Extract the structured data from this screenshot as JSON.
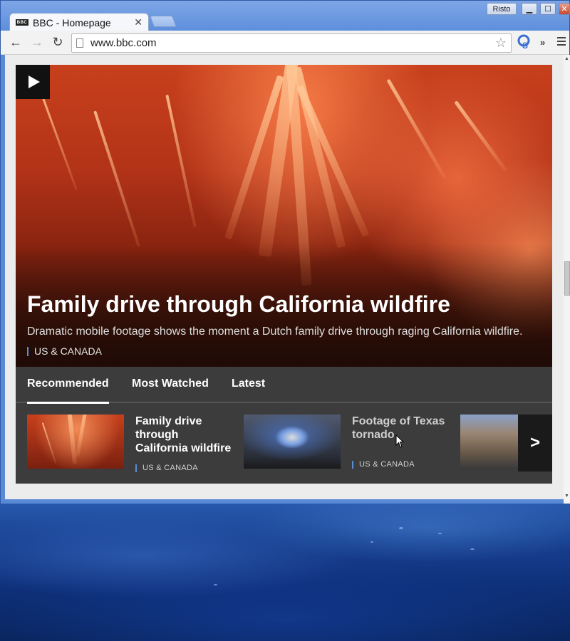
{
  "window": {
    "tab_title": "BBC - Homepage",
    "tab_favicon_text": "BBC",
    "tab_close": "✕",
    "user_name": "Risto",
    "minimize": "▁",
    "maximize": "☐",
    "close": "✕"
  },
  "toolbar": {
    "back": "←",
    "forward": "→",
    "reload": "↻",
    "url": "www.bbc.com",
    "star": "☆",
    "overflow": "»"
  },
  "hero": {
    "title": "Family drive through California wildfire",
    "summary": "Dramatic mobile footage shows the moment a Dutch family drive through raging California wildfire.",
    "tag": "US & CANADA"
  },
  "panel": {
    "tabs": [
      {
        "label": "Recommended",
        "active": true
      },
      {
        "label": "Most Watched",
        "active": false
      },
      {
        "label": "Latest",
        "active": false
      }
    ],
    "cards": [
      {
        "title_lines": [
          "Family drive",
          "through",
          "California wildfire"
        ],
        "tag": "US & CANADA"
      },
      {
        "title_lines": [
          "Footage of Texas",
          "tornado"
        ],
        "tag": "US & CANADA"
      }
    ],
    "next": ">"
  },
  "colors": {
    "accent_tag_bar": "#5a8fd8",
    "panel_bg": "#3c3c3c",
    "hero_fire": "#c8401c"
  }
}
